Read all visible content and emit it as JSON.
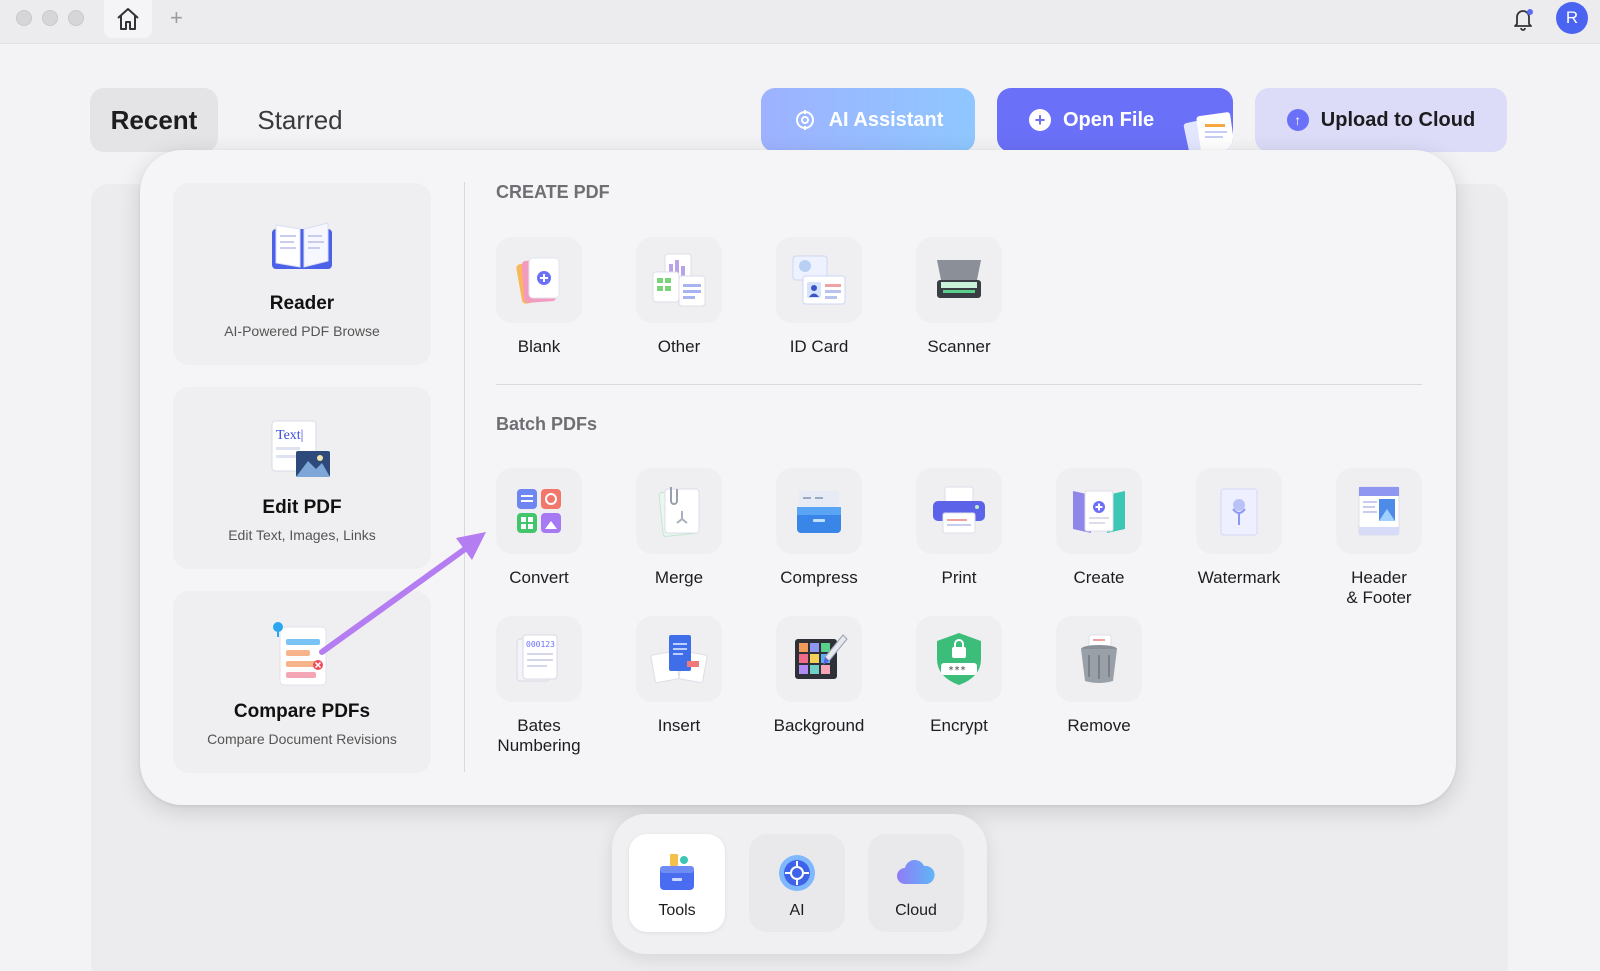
{
  "window": {
    "avatar_initial": "R",
    "new_tab_glyph": "+"
  },
  "tabs": [
    {
      "label": "Recent",
      "active": true
    },
    {
      "label": "Starred",
      "active": false
    }
  ],
  "actions": {
    "ai_assistant": "AI Assistant",
    "open_file": "Open File",
    "upload_to_cloud": "Upload to Cloud"
  },
  "side_cards": [
    {
      "title": "Reader",
      "subtitle": "AI-Powered PDF Browse",
      "icon": "book-icon"
    },
    {
      "title": "Edit PDF",
      "subtitle": "Edit Text, Images, Links",
      "icon": "edit-text-icon",
      "icon_text": "Text|"
    },
    {
      "title": "Compare PDFs",
      "subtitle": "Compare Document Revisions",
      "icon": "compare-icon"
    }
  ],
  "create_pdf": {
    "title": "CREATE PDF",
    "tools": [
      {
        "label": "Blank",
        "icon": "blank-doc-icon"
      },
      {
        "label": "Other",
        "icon": "other-docs-icon"
      },
      {
        "label": "ID Card",
        "icon": "id-card-icon"
      },
      {
        "label": "Scanner",
        "icon": "scanner-icon"
      }
    ]
  },
  "batch_pdfs": {
    "title": "Batch PDFs",
    "tools": [
      {
        "label": "Convert",
        "icon": "convert-icon"
      },
      {
        "label": "Merge",
        "icon": "merge-icon"
      },
      {
        "label": "Compress",
        "icon": "compress-icon"
      },
      {
        "label": "Print",
        "icon": "printer-icon"
      },
      {
        "label": "Create",
        "icon": "create-icon"
      },
      {
        "label": "Watermark",
        "icon": "watermark-icon"
      },
      {
        "label": "Header\n& Footer",
        "icon": "header-footer-icon"
      },
      {
        "label": "Bates\nNumbering",
        "icon": "bates-numbering-icon",
        "icon_text": "000123"
      },
      {
        "label": "Insert",
        "icon": "insert-icon"
      },
      {
        "label": "Background",
        "icon": "background-icon"
      },
      {
        "label": "Encrypt",
        "icon": "encrypt-icon",
        "icon_text": "***"
      },
      {
        "label": "Remove",
        "icon": "trash-icon"
      }
    ]
  },
  "dock": [
    {
      "label": "Tools",
      "active": true
    },
    {
      "label": "AI",
      "active": false
    },
    {
      "label": "Cloud",
      "active": false
    }
  ],
  "colors": {
    "accent": "#6a70f7",
    "arrow": "#b57df2"
  }
}
